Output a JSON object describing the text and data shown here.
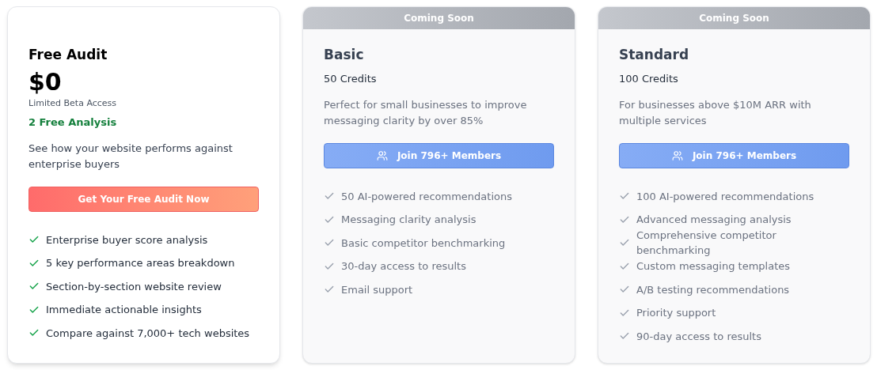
{
  "plans": [
    {
      "name": "Free Audit",
      "price": "$0",
      "subtitle": "Limited Beta Access",
      "highlight": "2 Free Analysis",
      "description": "See how your website performs against enterprise buyers",
      "button": {
        "label": "Get Your Free Audit Now",
        "kind": "primary"
      },
      "disabled": false,
      "features": [
        "Enterprise buyer score analysis",
        "5 key performance areas breakdown",
        "Section-by-section website review",
        "Immediate actionable insights",
        "Compare against 7,000+ tech websites"
      ]
    },
    {
      "badge": "Coming Soon",
      "name": "Basic",
      "credits": "50 Credits",
      "description": "Perfect for small businesses to improve messaging clarity by over 85%",
      "button": {
        "label": "Join 796+ Members",
        "kind": "waitlist"
      },
      "disabled": true,
      "features": [
        "50 AI-powered recommendations",
        "Messaging clarity analysis",
        "Basic competitor benchmarking",
        "30-day access to results",
        "Email support"
      ]
    },
    {
      "badge": "Coming Soon",
      "name": "Standard",
      "credits": "100 Credits",
      "description": "For businesses above $10M ARR with multiple services",
      "button": {
        "label": "Join 796+ Members",
        "kind": "waitlist"
      },
      "disabled": true,
      "features": [
        "100 AI-powered recommendations",
        "Advanced messaging analysis",
        "Comprehensive competitor benchmarking",
        "Custom messaging templates",
        "A/B testing recommendations",
        "Priority support",
        "90-day access to results"
      ]
    }
  ]
}
